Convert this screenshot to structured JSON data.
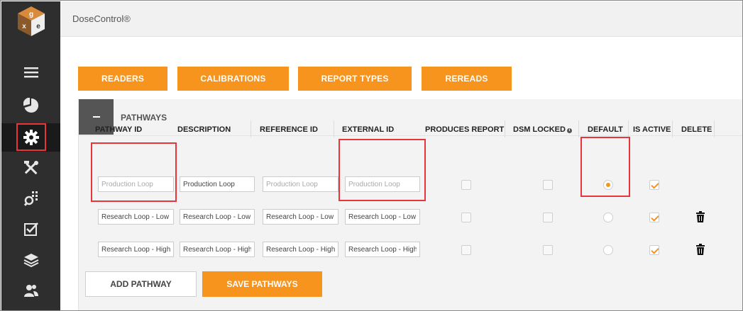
{
  "app": {
    "title": "DoseControl®"
  },
  "logo": {
    "letters": "gex"
  },
  "sidebar": {
    "items": [
      {
        "icon": "menu-icon"
      },
      {
        "icon": "dashboard-pie-icon"
      },
      {
        "icon": "settings-gear-icon",
        "active": true
      },
      {
        "icon": "tools-icon"
      },
      {
        "icon": "search-grid-icon"
      },
      {
        "icon": "checkbox-icon"
      },
      {
        "icon": "layers-icon"
      },
      {
        "icon": "users-icon"
      }
    ]
  },
  "nav": {
    "readers": "READERS",
    "calibrations": "CALIBRATIONS",
    "report_types": "REPORT TYPES",
    "rereads": "REREADS"
  },
  "panel": {
    "title": "PATHWAYS",
    "collapse_symbol": "–"
  },
  "columns": {
    "pathway_id": "PATHWAY ID",
    "description": "DESCRIPTION",
    "reference_id": "REFERENCE ID",
    "external_id": "EXTERNAL ID",
    "produces_report": "PRODUCES REPORT",
    "dsm_locked": "DSM LOCKED",
    "default": "DEFAULT",
    "is_active": "IS ACTIVE",
    "delete": "DELETE"
  },
  "rows": [
    {
      "pathway_id": {
        "value": "",
        "placeholder": "Production Loop"
      },
      "description": {
        "value": "Production Loop",
        "placeholder": ""
      },
      "reference_id": {
        "value": "",
        "placeholder": "Production Loop"
      },
      "external_id": {
        "value": "",
        "placeholder": "Production Loop"
      },
      "produces_report": false,
      "dsm_locked": false,
      "default": true,
      "is_active": true,
      "deletable": false
    },
    {
      "pathway_id": {
        "value": "Research Loop - Low",
        "placeholder": ""
      },
      "description": {
        "value": "Research Loop - Low",
        "placeholder": ""
      },
      "reference_id": {
        "value": "Research Loop - Low",
        "placeholder": ""
      },
      "external_id": {
        "value": "Research Loop - Low",
        "placeholder": ""
      },
      "produces_report": false,
      "dsm_locked": false,
      "default": false,
      "is_active": true,
      "deletable": true
    },
    {
      "pathway_id": {
        "value": "Research Loop - High",
        "placeholder": ""
      },
      "description": {
        "value": "Research Loop - High",
        "placeholder": ""
      },
      "reference_id": {
        "value": "Research Loop - High",
        "placeholder": ""
      },
      "external_id": {
        "value": "Research Loop - High",
        "placeholder": ""
      },
      "produces_report": false,
      "dsm_locked": false,
      "default": false,
      "is_active": true,
      "deletable": true
    }
  ],
  "actions": {
    "add_pathway": "ADD PATHWAY",
    "save_pathways": "SAVE PATHWAYS"
  },
  "colors": {
    "accent": "#f7941d",
    "sidebar": "#2e2e2e",
    "highlight": "#e8343a"
  }
}
